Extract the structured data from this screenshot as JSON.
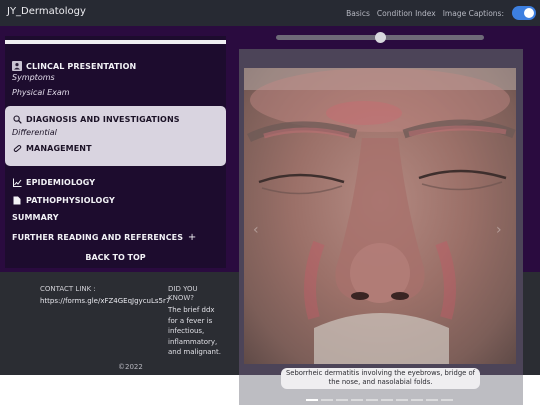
{
  "navbar": {
    "brand": "JY_Dermatology",
    "links": [
      "Basics",
      "Condition Index"
    ],
    "captions_label": "Image Captions:",
    "captions_on": true
  },
  "toc": {
    "clinical": {
      "label": "CLINCAL PRESENTATION",
      "icon": "person-icon",
      "items": [
        "Symptoms",
        "Physical Exam"
      ]
    },
    "diagnosis": {
      "label": "DIAGNOSIS AND INVESTIGATIONS",
      "icon": "search-icon",
      "items": [
        "Differential"
      ]
    },
    "management": {
      "label": "MANAGEMENT",
      "icon": "pill-icon"
    },
    "epidemiology": {
      "label": "EPIDEMIOLOGY",
      "icon": "chart-line-icon"
    },
    "pathophysiology": {
      "label": "PATHOPHYSIOLOGY",
      "icon": "document-icon"
    },
    "summary": {
      "label": "SUMMARY"
    },
    "further": {
      "label": "FURTHER READING AND REFERENCES",
      "icon": "plus-icon"
    },
    "back_to_top": "BACK TO TOP"
  },
  "footer": {
    "contact_label": "CONTACT LINK :",
    "contact_url": "https://forms.gle/xFZ4GEqJgycuLs5r7",
    "did_you_know_title": "DID YOU KNOW?",
    "did_you_know_text": "The brief ddx for a fever is infectious, inflammatory, and malignant.",
    "copyright": "©2022"
  },
  "carousel": {
    "caption": "Seborrheic dermatitis involving the eyebrows, bridge of the nose, and nasolabial folds.",
    "slide_count": 10,
    "active_slide": 1,
    "slider_position": 0.5,
    "prev_icon": "chevron-left-icon",
    "next_icon": "chevron-right-icon"
  }
}
